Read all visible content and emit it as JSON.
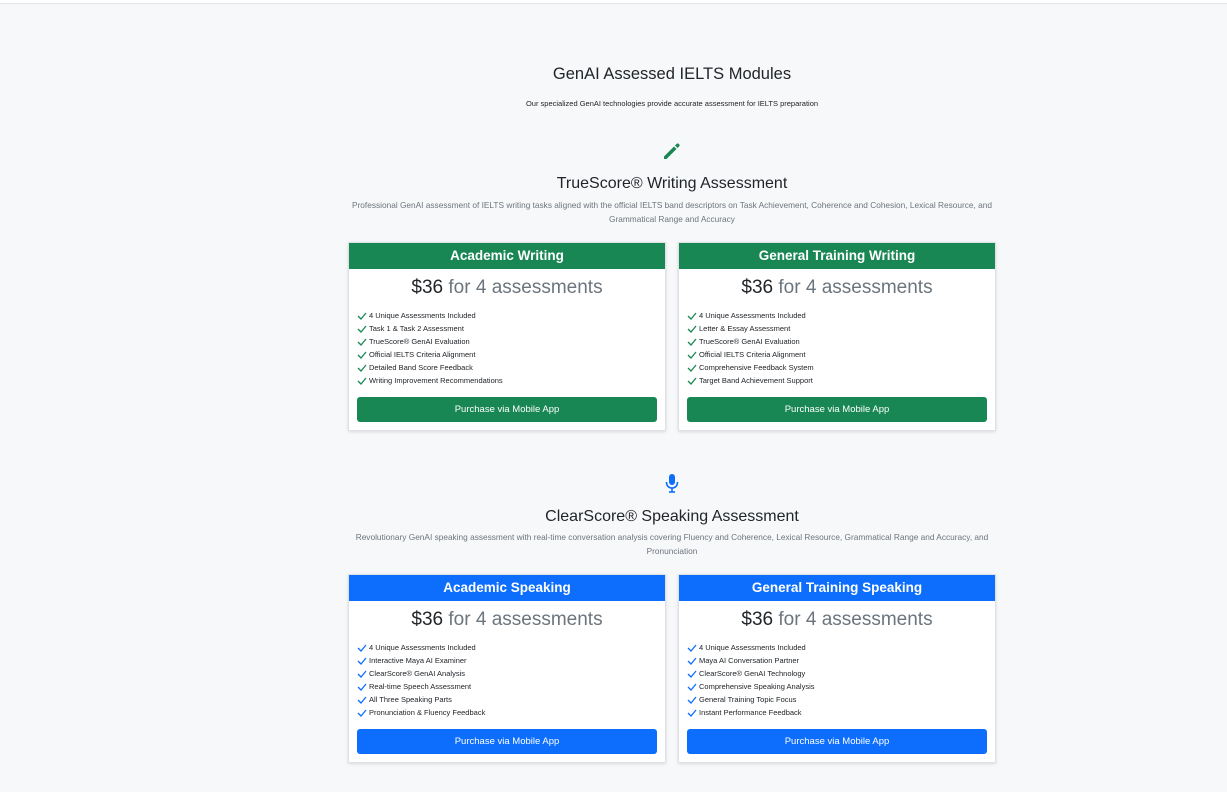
{
  "header": {
    "title": "GenAI Assessed IELTS Modules",
    "subtitle": "Our specialized GenAI technologies provide accurate assessment for IELTS preparation"
  },
  "colors": {
    "writing_accent": "#198754",
    "speaking_accent": "#0d6efd"
  },
  "writing": {
    "icon": "pencil-icon",
    "title": "TrueScore® Writing Assessment",
    "description": "Professional GenAI assessment of IELTS writing tasks aligned with the official IELTS band descriptors on Task Achievement, Coherence and Cohesion, Lexical Resource, and Grammatical Range and Accuracy",
    "cards": [
      {
        "title": "Academic Writing",
        "price": "$36",
        "price_unit": " for 4 assessments",
        "features": [
          "4 Unique Assessments Included",
          "Task 1 & Task 2 Assessment",
          "TrueScore® GenAI Evaluation",
          "Official IELTS Criteria Alignment",
          "Detailed Band Score Feedback",
          "Writing Improvement Recommendations"
        ],
        "button": "Purchase via Mobile App"
      },
      {
        "title": "General Training Writing",
        "price": "$36",
        "price_unit": " for 4 assessments",
        "features": [
          "4 Unique Assessments Included",
          "Letter & Essay Assessment",
          "TrueScore® GenAI Evaluation",
          "Official IELTS Criteria Alignment",
          "Comprehensive Feedback System",
          "Target Band Achievement Support"
        ],
        "button": "Purchase via Mobile App"
      }
    ]
  },
  "speaking": {
    "icon": "microphone-icon",
    "title": "ClearScore® Speaking Assessment",
    "description": "Revolutionary GenAI speaking assessment with real-time conversation analysis covering Fluency and Coherence, Lexical Resource, Grammatical Range and Accuracy, and Pronunciation",
    "cards": [
      {
        "title": "Academic Speaking",
        "price": "$36",
        "price_unit": " for 4 assessments",
        "features": [
          "4 Unique Assessments Included",
          "Interactive Maya AI Examiner",
          "ClearScore® GenAI Analysis",
          "Real-time Speech Assessment",
          "All Three Speaking Parts",
          "Pronunciation & Fluency Feedback"
        ],
        "button": "Purchase via Mobile App"
      },
      {
        "title": "General Training Speaking",
        "price": "$36",
        "price_unit": " for 4 assessments",
        "features": [
          "4 Unique Assessments Included",
          "Maya AI Conversation Partner",
          "ClearScore® GenAI Technology",
          "Comprehensive Speaking Analysis",
          "General Training Topic Focus",
          "Instant Performance Feedback"
        ],
        "button": "Purchase via Mobile App"
      }
    ]
  }
}
